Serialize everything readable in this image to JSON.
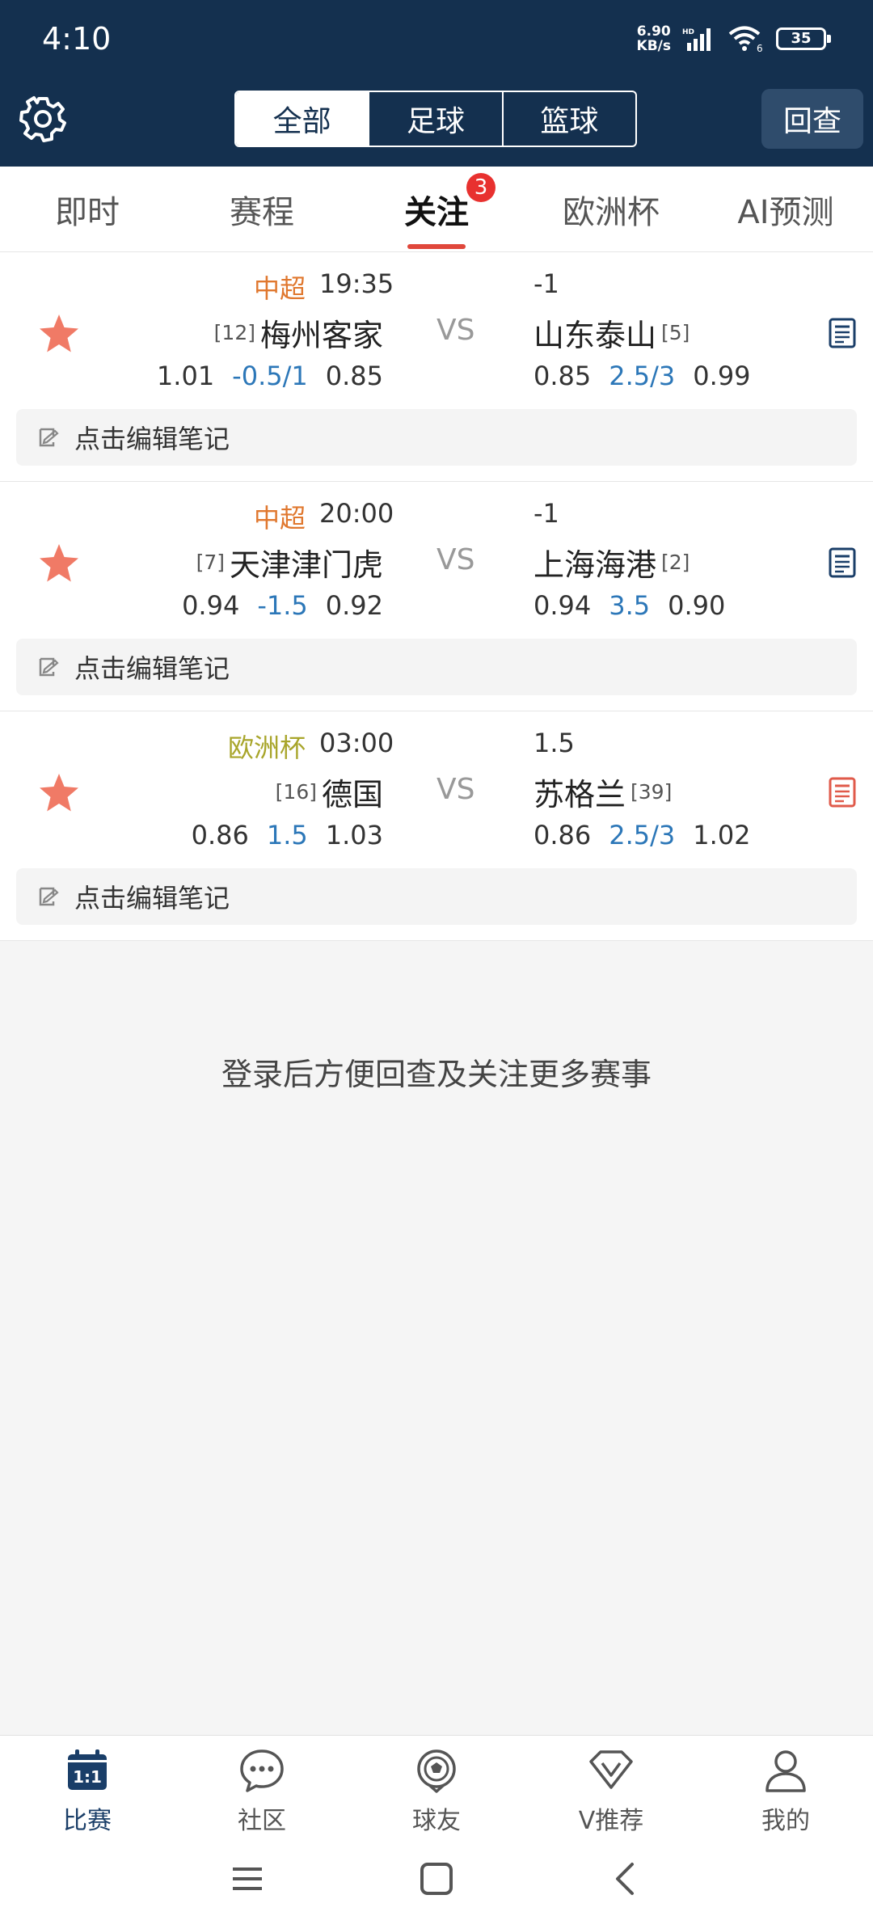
{
  "status_bar": {
    "time": "4:10",
    "net_speed_value": "6.90",
    "net_speed_unit": "KB/s",
    "battery": "35"
  },
  "header": {
    "segments": [
      "全部",
      "足球",
      "篮球"
    ],
    "review_label": "回查"
  },
  "tabs": [
    {
      "label": "即时"
    },
    {
      "label": "赛程"
    },
    {
      "label": "关注",
      "badge": "3"
    },
    {
      "label": "欧洲杯"
    },
    {
      "label": "AI预测"
    }
  ],
  "matches": [
    {
      "league": "中超",
      "league_color": "#e0782f",
      "time": "19:35",
      "handicap": "-1",
      "home_rank": "[12]",
      "home": "梅州客家",
      "vs": "VS",
      "away": "山东泰山",
      "away_rank": "[5]",
      "odds_left": [
        "1.01",
        "-0.5/1",
        "0.85"
      ],
      "odds_right": [
        "0.85",
        "2.5/3",
        "0.99"
      ],
      "note": "点击编辑笔记",
      "doc_color": "#1a3e68"
    },
    {
      "league": "中超",
      "league_color": "#e0782f",
      "time": "20:00",
      "handicap": "-1",
      "home_rank": "[7]",
      "home": "天津津门虎",
      "vs": "VS",
      "away": "上海海港",
      "away_rank": "[2]",
      "odds_left": [
        "0.94",
        "-1.5",
        "0.92"
      ],
      "odds_right": [
        "0.94",
        "3.5",
        "0.90"
      ],
      "note": "点击编辑笔记",
      "doc_color": "#1a3e68"
    },
    {
      "league": "欧洲杯",
      "league_color": "#a8a52a",
      "time": "03:00",
      "handicap": "1.5",
      "home_rank": "[16]",
      "home": "德国",
      "vs": "VS",
      "away": "苏格兰",
      "away_rank": "[39]",
      "odds_left": [
        "0.86",
        "1.5",
        "1.03"
      ],
      "odds_right": [
        "0.86",
        "2.5/3",
        "1.02"
      ],
      "note": "点击编辑笔记",
      "doc_color": "#e05a4a"
    }
  ],
  "login_hint": "登录后方便回查及关注更多赛事",
  "bottom_nav": [
    {
      "label": "比赛",
      "icon": "calendar-icon",
      "icon_text": "1:1"
    },
    {
      "label": "社区",
      "icon": "chat-icon"
    },
    {
      "label": "球友",
      "icon": "football-icon"
    },
    {
      "label": "V推荐",
      "icon": "diamond-icon"
    },
    {
      "label": "我的",
      "icon": "user-icon"
    }
  ],
  "colors": {
    "header_bg": "#14304f",
    "accent_red": "#e0473b",
    "star": "#f07a66",
    "odds_blue": "#2c77b8"
  }
}
